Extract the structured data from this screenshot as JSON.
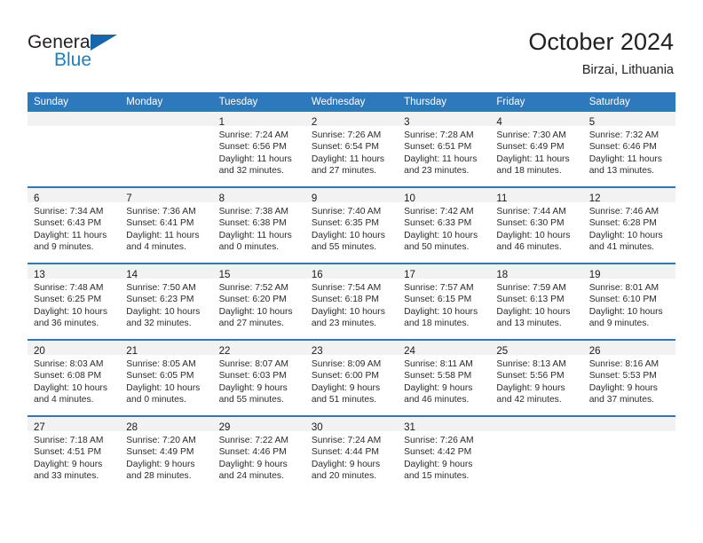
{
  "brand": {
    "word_one": "General",
    "word_two": "Blue",
    "flag_icon": "triangle-flag-icon",
    "color_dark": "#231f20",
    "color_blue": "#1f7ec4",
    "flag_color": "#1666ac"
  },
  "header": {
    "title": "October 2024",
    "subtitle": "Birzai, Lithuania"
  },
  "theme": {
    "header_blue": "#2e79bd",
    "daynum_band": "#f2f2f2",
    "cell_background": "#ffffff",
    "text": "#2b2b2b"
  },
  "calendar": {
    "weekday_headers": [
      "Sunday",
      "Monday",
      "Tuesday",
      "Wednesday",
      "Thursday",
      "Friday",
      "Saturday"
    ],
    "weeks": [
      [
        {
          "day": "",
          "lines": []
        },
        {
          "day": "",
          "lines": []
        },
        {
          "day": "1",
          "lines": [
            "Sunrise: 7:24 AM",
            "Sunset: 6:56 PM",
            "Daylight: 11 hours",
            "and 32 minutes."
          ]
        },
        {
          "day": "2",
          "lines": [
            "Sunrise: 7:26 AM",
            "Sunset: 6:54 PM",
            "Daylight: 11 hours",
            "and 27 minutes."
          ]
        },
        {
          "day": "3",
          "lines": [
            "Sunrise: 7:28 AM",
            "Sunset: 6:51 PM",
            "Daylight: 11 hours",
            "and 23 minutes."
          ]
        },
        {
          "day": "4",
          "lines": [
            "Sunrise: 7:30 AM",
            "Sunset: 6:49 PM",
            "Daylight: 11 hours",
            "and 18 minutes."
          ]
        },
        {
          "day": "5",
          "lines": [
            "Sunrise: 7:32 AM",
            "Sunset: 6:46 PM",
            "Daylight: 11 hours",
            "and 13 minutes."
          ]
        }
      ],
      [
        {
          "day": "6",
          "lines": [
            "Sunrise: 7:34 AM",
            "Sunset: 6:43 PM",
            "Daylight: 11 hours",
            "and 9 minutes."
          ]
        },
        {
          "day": "7",
          "lines": [
            "Sunrise: 7:36 AM",
            "Sunset: 6:41 PM",
            "Daylight: 11 hours",
            "and 4 minutes."
          ]
        },
        {
          "day": "8",
          "lines": [
            "Sunrise: 7:38 AM",
            "Sunset: 6:38 PM",
            "Daylight: 11 hours",
            "and 0 minutes."
          ]
        },
        {
          "day": "9",
          "lines": [
            "Sunrise: 7:40 AM",
            "Sunset: 6:35 PM",
            "Daylight: 10 hours",
            "and 55 minutes."
          ]
        },
        {
          "day": "10",
          "lines": [
            "Sunrise: 7:42 AM",
            "Sunset: 6:33 PM",
            "Daylight: 10 hours",
            "and 50 minutes."
          ]
        },
        {
          "day": "11",
          "lines": [
            "Sunrise: 7:44 AM",
            "Sunset: 6:30 PM",
            "Daylight: 10 hours",
            "and 46 minutes."
          ]
        },
        {
          "day": "12",
          "lines": [
            "Sunrise: 7:46 AM",
            "Sunset: 6:28 PM",
            "Daylight: 10 hours",
            "and 41 minutes."
          ]
        }
      ],
      [
        {
          "day": "13",
          "lines": [
            "Sunrise: 7:48 AM",
            "Sunset: 6:25 PM",
            "Daylight: 10 hours",
            "and 36 minutes."
          ]
        },
        {
          "day": "14",
          "lines": [
            "Sunrise: 7:50 AM",
            "Sunset: 6:23 PM",
            "Daylight: 10 hours",
            "and 32 minutes."
          ]
        },
        {
          "day": "15",
          "lines": [
            "Sunrise: 7:52 AM",
            "Sunset: 6:20 PM",
            "Daylight: 10 hours",
            "and 27 minutes."
          ]
        },
        {
          "day": "16",
          "lines": [
            "Sunrise: 7:54 AM",
            "Sunset: 6:18 PM",
            "Daylight: 10 hours",
            "and 23 minutes."
          ]
        },
        {
          "day": "17",
          "lines": [
            "Sunrise: 7:57 AM",
            "Sunset: 6:15 PM",
            "Daylight: 10 hours",
            "and 18 minutes."
          ]
        },
        {
          "day": "18",
          "lines": [
            "Sunrise: 7:59 AM",
            "Sunset: 6:13 PM",
            "Daylight: 10 hours",
            "and 13 minutes."
          ]
        },
        {
          "day": "19",
          "lines": [
            "Sunrise: 8:01 AM",
            "Sunset: 6:10 PM",
            "Daylight: 10 hours",
            "and 9 minutes."
          ]
        }
      ],
      [
        {
          "day": "20",
          "lines": [
            "Sunrise: 8:03 AM",
            "Sunset: 6:08 PM",
            "Daylight: 10 hours",
            "and 4 minutes."
          ]
        },
        {
          "day": "21",
          "lines": [
            "Sunrise: 8:05 AM",
            "Sunset: 6:05 PM",
            "Daylight: 10 hours",
            "and 0 minutes."
          ]
        },
        {
          "day": "22",
          "lines": [
            "Sunrise: 8:07 AM",
            "Sunset: 6:03 PM",
            "Daylight: 9 hours",
            "and 55 minutes."
          ]
        },
        {
          "day": "23",
          "lines": [
            "Sunrise: 8:09 AM",
            "Sunset: 6:00 PM",
            "Daylight: 9 hours",
            "and 51 minutes."
          ]
        },
        {
          "day": "24",
          "lines": [
            "Sunrise: 8:11 AM",
            "Sunset: 5:58 PM",
            "Daylight: 9 hours",
            "and 46 minutes."
          ]
        },
        {
          "day": "25",
          "lines": [
            "Sunrise: 8:13 AM",
            "Sunset: 5:56 PM",
            "Daylight: 9 hours",
            "and 42 minutes."
          ]
        },
        {
          "day": "26",
          "lines": [
            "Sunrise: 8:16 AM",
            "Sunset: 5:53 PM",
            "Daylight: 9 hours",
            "and 37 minutes."
          ]
        }
      ],
      [
        {
          "day": "27",
          "lines": [
            "Sunrise: 7:18 AM",
            "Sunset: 4:51 PM",
            "Daylight: 9 hours",
            "and 33 minutes."
          ]
        },
        {
          "day": "28",
          "lines": [
            "Sunrise: 7:20 AM",
            "Sunset: 4:49 PM",
            "Daylight: 9 hours",
            "and 28 minutes."
          ]
        },
        {
          "day": "29",
          "lines": [
            "Sunrise: 7:22 AM",
            "Sunset: 4:46 PM",
            "Daylight: 9 hours",
            "and 24 minutes."
          ]
        },
        {
          "day": "30",
          "lines": [
            "Sunrise: 7:24 AM",
            "Sunset: 4:44 PM",
            "Daylight: 9 hours",
            "and 20 minutes."
          ]
        },
        {
          "day": "31",
          "lines": [
            "Sunrise: 7:26 AM",
            "Sunset: 4:42 PM",
            "Daylight: 9 hours",
            "and 15 minutes."
          ]
        },
        {
          "day": "",
          "lines": []
        },
        {
          "day": "",
          "lines": []
        }
      ]
    ]
  }
}
